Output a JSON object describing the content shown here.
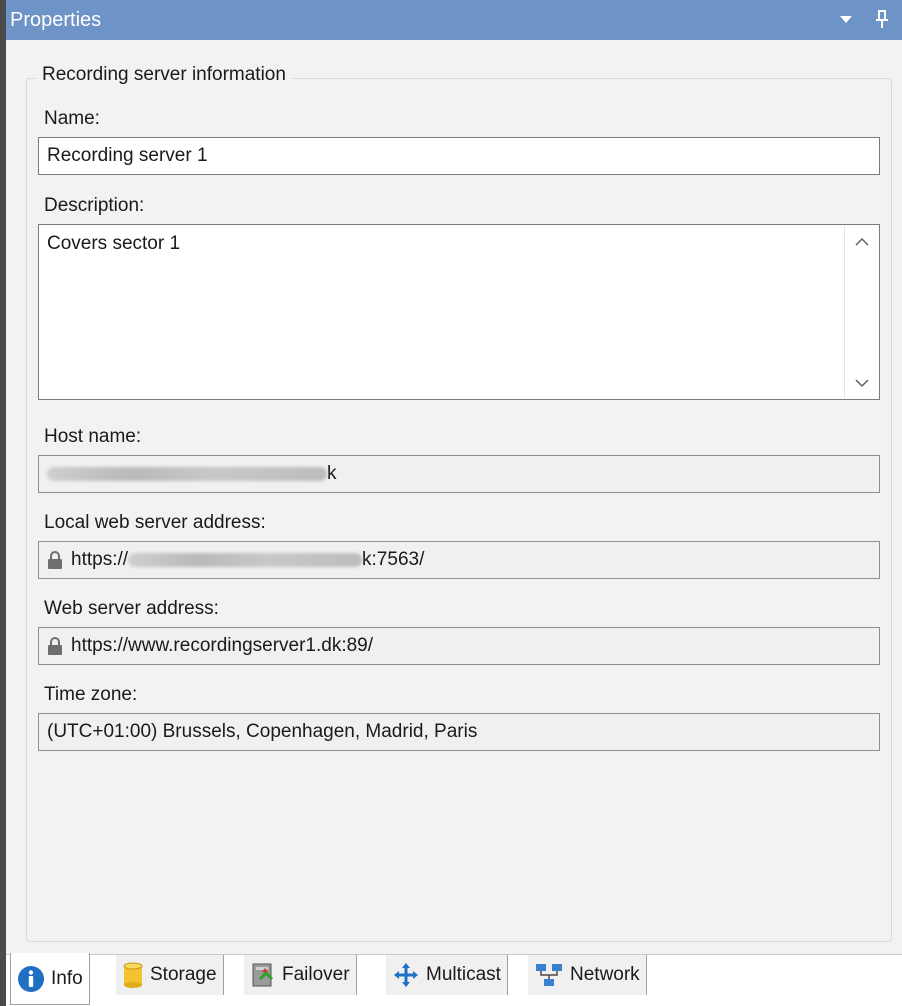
{
  "panel": {
    "title": "Properties",
    "icons": [
      "dropdown-arrow-icon",
      "pin-icon"
    ]
  },
  "group": {
    "legend": "Recording server information"
  },
  "fields": {
    "name_label": "Name:",
    "name_value": "Recording server 1",
    "description_label": "Description:",
    "description_value": "Covers sector 1",
    "host_label": "Host name:",
    "host_value_suffix": "k",
    "local_label": "Local web server address:",
    "local_prefix": "https://",
    "local_suffix": "k:7563/",
    "web_label": "Web server address:",
    "web_value": "https://www.recordingserver1.dk:89/",
    "tz_label": "Time zone:",
    "tz_value": "(UTC+01:00) Brussels, Copenhagen, Madrid, Paris"
  },
  "tabs": [
    {
      "label": "Info",
      "icon": "info-icon"
    },
    {
      "label": "Storage",
      "icon": "storage-icon"
    },
    {
      "label": "Failover",
      "icon": "failover-icon"
    },
    {
      "label": "Multicast",
      "icon": "multicast-icon"
    },
    {
      "label": "Network",
      "icon": "network-icon"
    }
  ],
  "active_tab": "Info",
  "colors": {
    "titlebar": "#6d93c7",
    "info_icon": "#1f6fc4",
    "storage_icon": "#f2c230"
  }
}
